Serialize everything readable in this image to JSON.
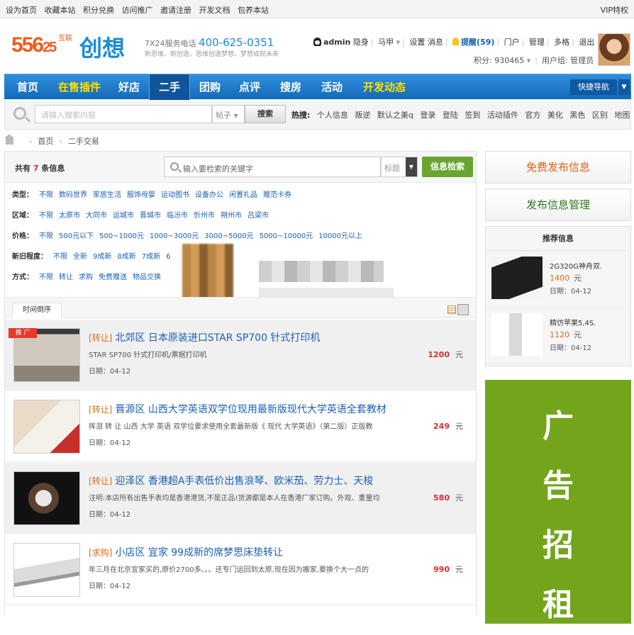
{
  "topbar": {
    "links": [
      "设为首页",
      "收藏本站",
      "积分兑换",
      "访问推广",
      "邀请注册",
      "开发文档",
      "包养本站"
    ],
    "vip": "VIP特权"
  },
  "logo": {
    "num_top": "556",
    "num_bottom": "25",
    "small_top": "互联",
    "cn": "创想"
  },
  "slogan": {
    "prefix": "7X24服务电话",
    "phone": "400-625-0351",
    "sub": "新思维、新创造，思维创造梦想，梦想成就未来"
  },
  "user": {
    "name": "admin",
    "status": "隐身",
    "majia": "马甲",
    "settings": "设置",
    "messages": "消息",
    "remind": "提醒(59)",
    "portal": "门户",
    "manage": "管理",
    "multi": "多格",
    "logout": "退出",
    "points": "积分: 930465",
    "group": "用户组: 管理员"
  },
  "nav": {
    "items": [
      "首页",
      "在售插件",
      "好店",
      "二手",
      "团购",
      "点评",
      "搜房",
      "活动",
      "开发动态"
    ],
    "quick": "快捷导航"
  },
  "search": {
    "placeholder": "请输入搜索内容",
    "type": "帖子",
    "button": "搜索",
    "hot_label": "热搜:",
    "hot": [
      "个人信息",
      "叛逆",
      "默认之美q",
      "登录",
      "登陆",
      "签到",
      "活动插件",
      "官方",
      "美化",
      "黑色",
      "区别",
      "地图"
    ]
  },
  "breadcrumb": {
    "home": "首页",
    "current": "二手交易"
  },
  "listing_header": {
    "count_prefix": "共有",
    "count": "7",
    "count_suffix": "条信息",
    "keyword_placeholder": "输入要检索的关键字",
    "field": "标题",
    "button": "信息检索"
  },
  "filters": [
    {
      "label": "类型：",
      "items": [
        "不限",
        "数码世界",
        "家居生活",
        "服饰母婴",
        "运动图书",
        "设备办公",
        "闲置礼品",
        "赠范卡券"
      ]
    },
    {
      "label": "区域：",
      "items": [
        "不限",
        "太原市",
        "大同市",
        "运城市",
        "晋城市",
        "临汾市",
        "忻州市",
        "朔州市",
        "吕梁市"
      ]
    },
    {
      "label": "价格：",
      "items": [
        "不限",
        "500元以下",
        "500~1000元",
        "1000~3000元",
        "3000~5000元",
        "5000~10000元",
        "10000元以上"
      ]
    },
    {
      "label": "新旧程度：",
      "items": [
        "不限",
        "全新",
        "9成新",
        "8成新",
        "7成新",
        "6"
      ]
    },
    {
      "label": "方式：",
      "items": [
        "不限",
        "转让",
        "求购",
        "免费赠送",
        "物品交换"
      ]
    }
  ],
  "sort_tab": "时间倒序",
  "listings": [
    {
      "type": "[转让]",
      "title": "北郊区 日本原装进口STAR SP700 针式打印机",
      "desc": "STAR SP700 针式打印机/票据打印机",
      "date": "日期：04-12",
      "price": "1200",
      "unit": "元",
      "tag": "推 广"
    },
    {
      "type": "[转让]",
      "title": "晋源区 山西大学英语双学位现用最新版现代大学英语全套教材",
      "desc": "挥泪 转 让 山西 大学 英语 双学位要求使用全套最新版《 现代 大学英语》（第二版）正版教",
      "date": "日期：04-12",
      "price": "249",
      "unit": "元"
    },
    {
      "type": "[转让]",
      "title": "迎泽区 香港超A手表低价出售浪琴、欧米茄、劳力士、天梭",
      "desc": "注明:本店所有出售手表均是香港港货,不是正品!货源都是本人在香港厂家订购。外观、重量均",
      "date": "日期：04-12",
      "price": "580",
      "unit": "元"
    },
    {
      "type": "[求购]",
      "title": "小店区 宜家 99成新的席梦思床垫转让",
      "desc": "年三月在北京宜家买的,原价2700多。。。还专门运回到太原,现在因为搬家,要换个大一点的",
      "date": "日期：04-12",
      "price": "990",
      "unit": "元"
    }
  ],
  "sidebar": {
    "publish": "免费发布信息",
    "manage": "发布信息管理",
    "rec_title": "推荐信息",
    "rec": [
      {
        "title": "2G320G神舟双.",
        "price": "1400",
        "unit": "元",
        "date": "日期：04-12"
      },
      {
        "title": "精仿苹果5,4S.",
        "price": "1120",
        "unit": "元",
        "date": "日期：04-12"
      }
    ],
    "ad": [
      "广",
      "告",
      "招",
      "租"
    ]
  }
}
